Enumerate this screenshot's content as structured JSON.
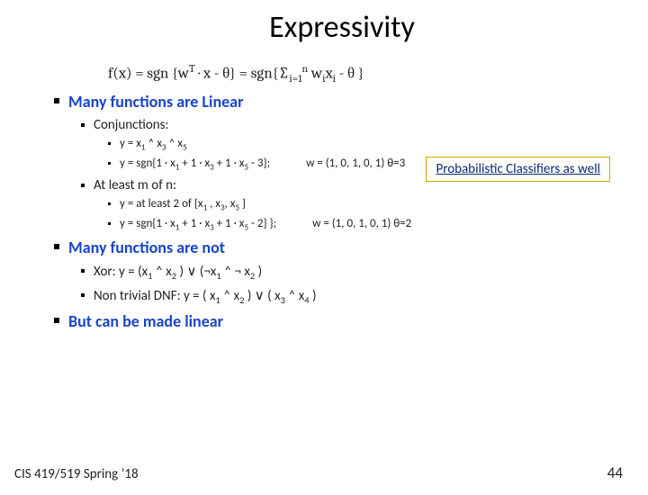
{
  "title": "Expressivity",
  "formula_html": "f(x) = sgn {w<span class='sup'>T</span> · x - θ} = sgn{∑<span class='sub'>i=1</span><span class='sup'>n</span> w<span class='sub'>i</span>x<span class='sub'>i</span> - θ }",
  "callout": "Probabilistic Classifiers as well",
  "sections": {
    "linear_heading": "Many functions are Linear",
    "conjunctions_label": "Conjunctions:",
    "conj_line1_html": "y = x<span class='sub'>1</span> ˄ x<span class='sub'>3</span> ˄ x<span class='sub'>5</span>",
    "conj_line2_left_html": "y = sgn{1 · x<span class='sub'>1</span> + 1 · x<span class='sub'>3</span> + 1 · x<span class='sub'>5</span> - 3};",
    "conj_line2_right_html": "w = (1, 0, 1, 0, 1) θ=3",
    "atleast_label": "At least m of n:",
    "atleast_line1_html": "y = at least 2 of {x<span class='sub'>1</span> , x<span class='sub'>3</span>, x<span class='sub'>5</span> }",
    "atleast_line2_left_html": "y = sgn{1 · x<span class='sub'>1</span> + 1 · x<span class='sub'>3</span> + 1 · x<span class='sub'>5</span> - 2} };",
    "atleast_line2_right_html": "w = (1, 0, 1, 0, 1) θ=2",
    "notlinear_heading": "Many functions are not",
    "xor_html": "Xor: y = (x<span class='sub'>1</span> ˄ x<span class='sub'>2</span> ) ∨ (¬x<span class='sub'>1</span> ˄ ¬ x<span class='sub'>2</span> )",
    "dnf_html": "Non trivial DNF: y = ( x<span class='sub'>1</span> ˄ x<span class='sub'>2</span> ) ∨ (  x<span class='sub'>3</span> ˄ x<span class='sub'>4</span> )",
    "madelinear_heading": "But can be made linear"
  },
  "footer": {
    "left": "CIS 419/519 Spring ’18",
    "right": "44"
  }
}
